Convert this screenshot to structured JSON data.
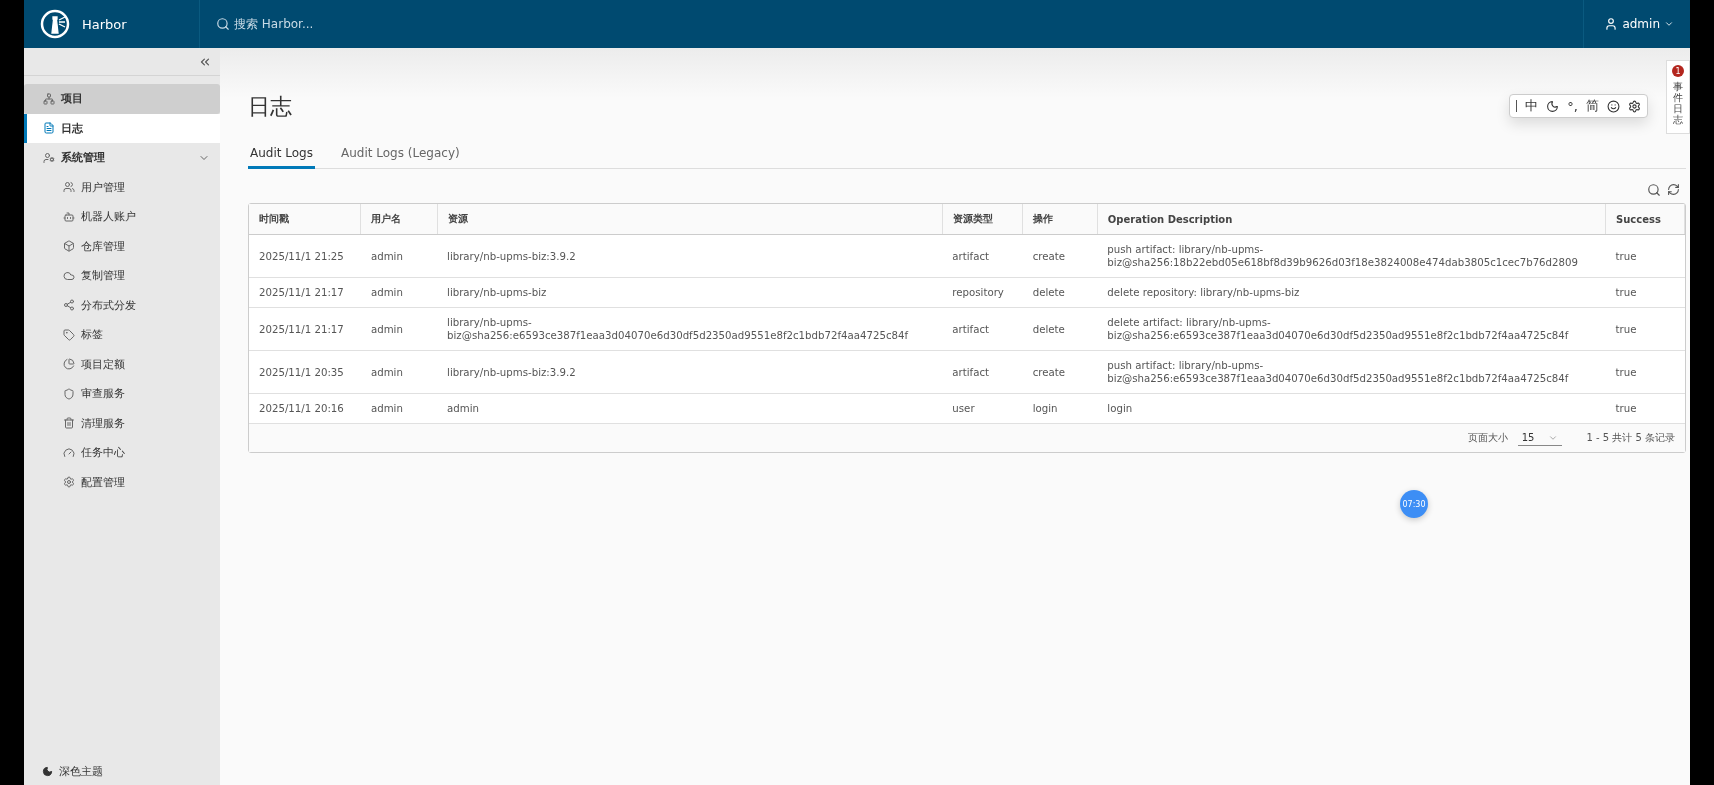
{
  "header": {
    "brand": "Harbor",
    "search_placeholder": "搜索 Harbor...",
    "user": "admin"
  },
  "sidebar": {
    "items": [
      {
        "label": "项目",
        "selected": false,
        "hovered": true
      },
      {
        "label": "日志",
        "selected": true,
        "hovered": false
      },
      {
        "label": "系统管理",
        "selected": false,
        "hovered": false,
        "expanded": true,
        "children": [
          {
            "label": "用户管理",
            "selected": false
          },
          {
            "label": "机器人账户",
            "selected": false
          },
          {
            "label": "仓库管理",
            "selected": false
          },
          {
            "label": "复制管理",
            "selected": false
          },
          {
            "label": "分布式分发",
            "selected": false
          },
          {
            "label": "标签",
            "selected": false
          },
          {
            "label": "项目定额",
            "selected": false
          },
          {
            "label": "审查服务",
            "selected": false
          },
          {
            "label": "清理服务",
            "selected": false
          },
          {
            "label": "任务中心",
            "selected": false
          },
          {
            "label": "配置管理",
            "selected": false
          }
        ]
      }
    ],
    "theme_toggle": "深色主题"
  },
  "page_title": "日志",
  "tabs": [
    {
      "label": "Audit Logs",
      "selected": true
    },
    {
      "label": "Audit Logs (Legacy)",
      "selected": false
    }
  ],
  "table": {
    "columns": [
      "时间戳",
      "用户名",
      "资源",
      "资源类型",
      "操作",
      "Operation Description",
      "Success"
    ],
    "rows": [
      [
        "2025/11/1 21:25",
        "admin",
        "library/nb-upms-biz:3.9.2",
        "artifact",
        "create",
        "push artifact: library/nb-upms-biz@sha256:18b22ebd05e618bf8d39b9626d03f18e3824008e474dab3805c1cec7b76d2809",
        "true"
      ],
      [
        "2025/11/1 21:17",
        "admin",
        "library/nb-upms-biz",
        "repository",
        "delete",
        "delete repository: library/nb-upms-biz",
        "true"
      ],
      [
        "2025/11/1 21:17",
        "admin",
        "library/nb-upms-biz@sha256:e6593ce387f1eaa3d04070e6d30df5d2350ad9551e8f2c1bdb72f4aa4725c84f",
        "artifact",
        "delete",
        "delete artifact: library/nb-upms-biz@sha256:e6593ce387f1eaa3d04070e6d30df5d2350ad9551e8f2c1bdb72f4aa4725c84f",
        "true"
      ],
      [
        "2025/11/1 20:35",
        "admin",
        "library/nb-upms-biz:3.9.2",
        "artifact",
        "create",
        "push artifact: library/nb-upms-biz@sha256:e6593ce387f1eaa3d04070e6d30df5d2350ad9551e8f2c1bdb72f4aa4725c84f",
        "true"
      ],
      [
        "2025/11/1 20:16",
        "admin",
        "admin",
        "user",
        "login",
        "login",
        "true"
      ]
    ],
    "pagination": {
      "size_label": "页面大小",
      "page_size": "15",
      "summary": "1 - 5 共计 5 条记录"
    }
  },
  "ime_toolbar": {
    "items": [
      {
        "kind": "text",
        "label": "中"
      },
      {
        "kind": "moon"
      },
      {
        "kind": "text",
        "label": "°,"
      },
      {
        "kind": "text",
        "label": "简"
      },
      {
        "kind": "smile"
      },
      {
        "kind": "gear"
      }
    ]
  },
  "side_tab": {
    "label": "事件日志",
    "badge": "1"
  },
  "timer": "07:30"
}
